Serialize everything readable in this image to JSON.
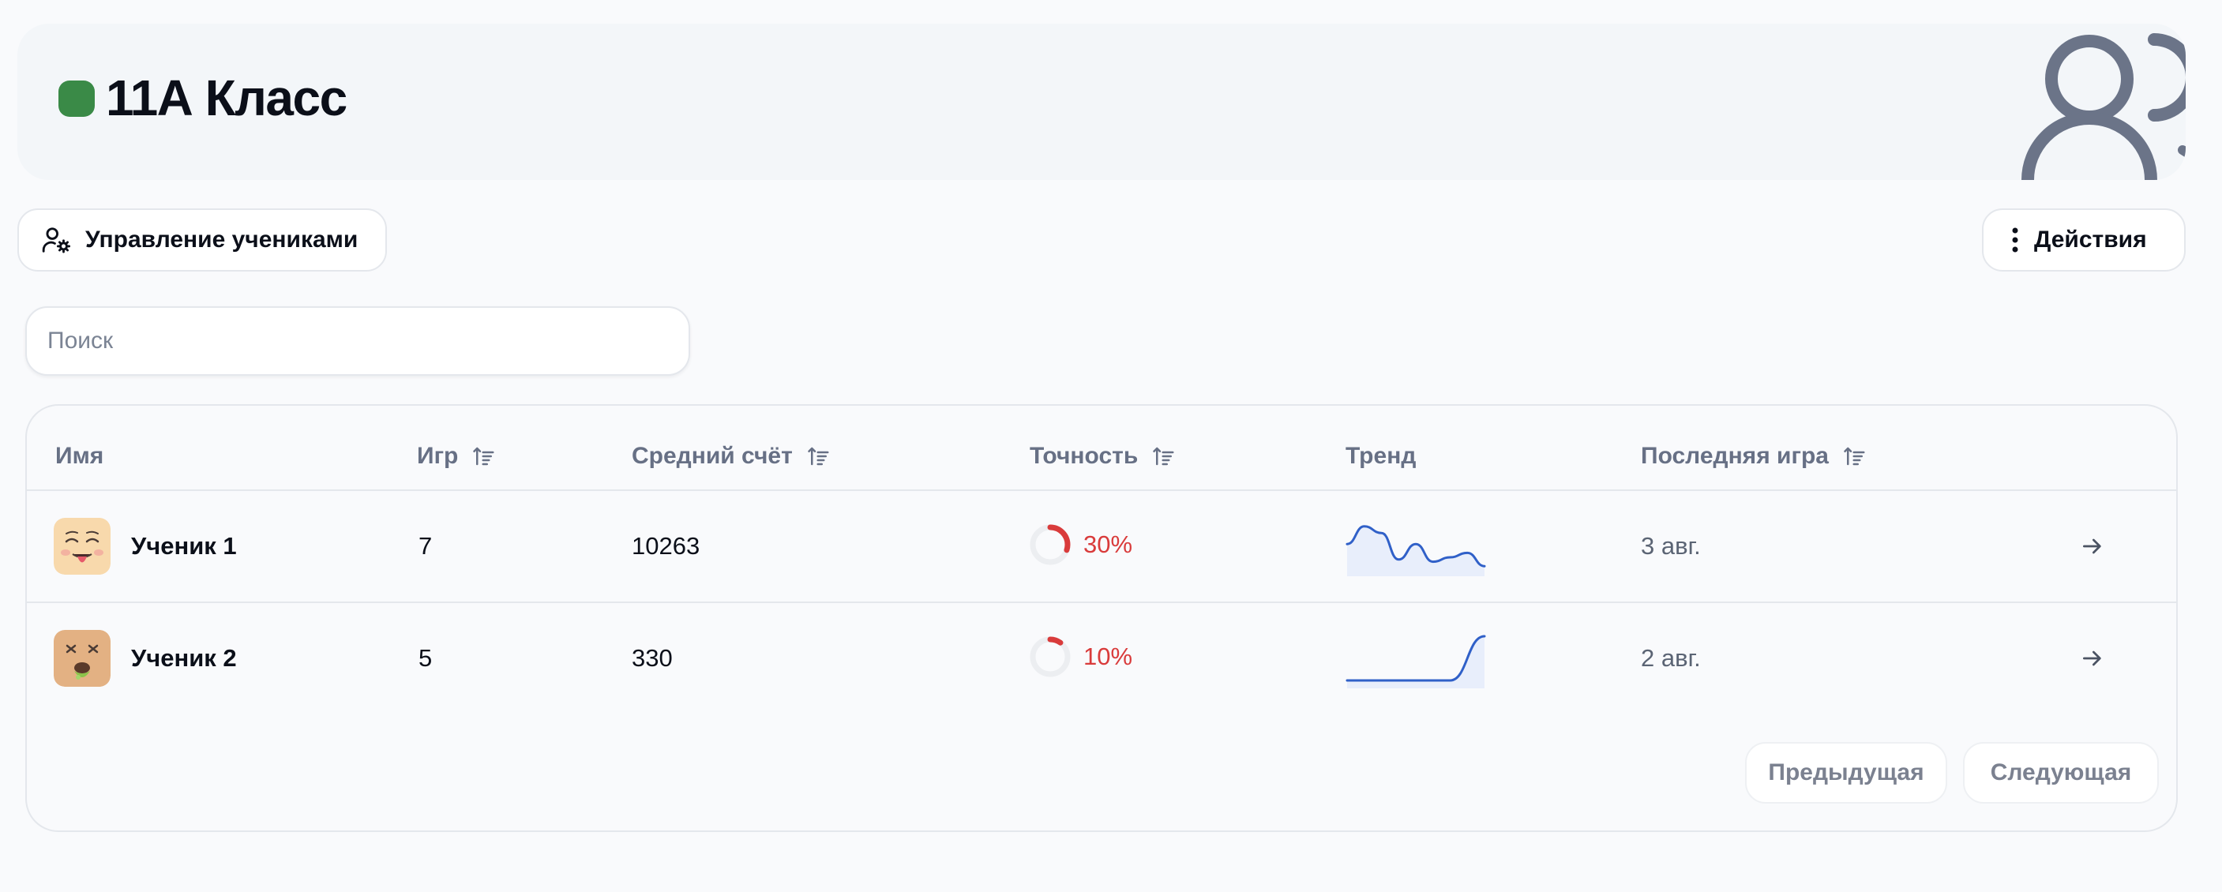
{
  "header": {
    "title": "11А Класс",
    "status_color": "#3a8a47"
  },
  "toolbar": {
    "manage_label": "Управление учениками",
    "manage_icon": "user-gear-icon",
    "actions_label": "Действия",
    "actions_icon": "more-vertical-icon"
  },
  "search": {
    "placeholder": "Поиск",
    "value": ""
  },
  "table": {
    "columns": {
      "name": "Имя",
      "games": "Игр",
      "avg_score": "Средний счёт",
      "accuracy": "Точность",
      "trend": "Тренд",
      "last_game": "Последняя игра"
    },
    "rows": [
      {
        "name": "Ученик 1",
        "avatar": "tongue-out-face-icon",
        "games": "7",
        "avg_score": "10263",
        "accuracy": "30%",
        "accuracy_value": 0.3,
        "trend": [
          0.55,
          0.95,
          0.8,
          0.2,
          0.55,
          0.15,
          0.25,
          0.35,
          0.05
        ],
        "last_game": "3 авг."
      },
      {
        "name": "Ученик 2",
        "avatar": "dizzy-sick-face-icon",
        "games": "5",
        "avg_score": "330",
        "accuracy": "10%",
        "accuracy_value": 0.1,
        "trend": [
          0.0,
          0.0,
          0.0,
          0.0,
          1.0
        ],
        "last_game": "2 авг."
      }
    ]
  },
  "pagination": {
    "prev_label": "Предыдущая",
    "next_label": "Следующая"
  },
  "colors": {
    "accuracy_low": "#d93b3b",
    "trend_line": "#3060c8",
    "muted_text": "#677085"
  }
}
